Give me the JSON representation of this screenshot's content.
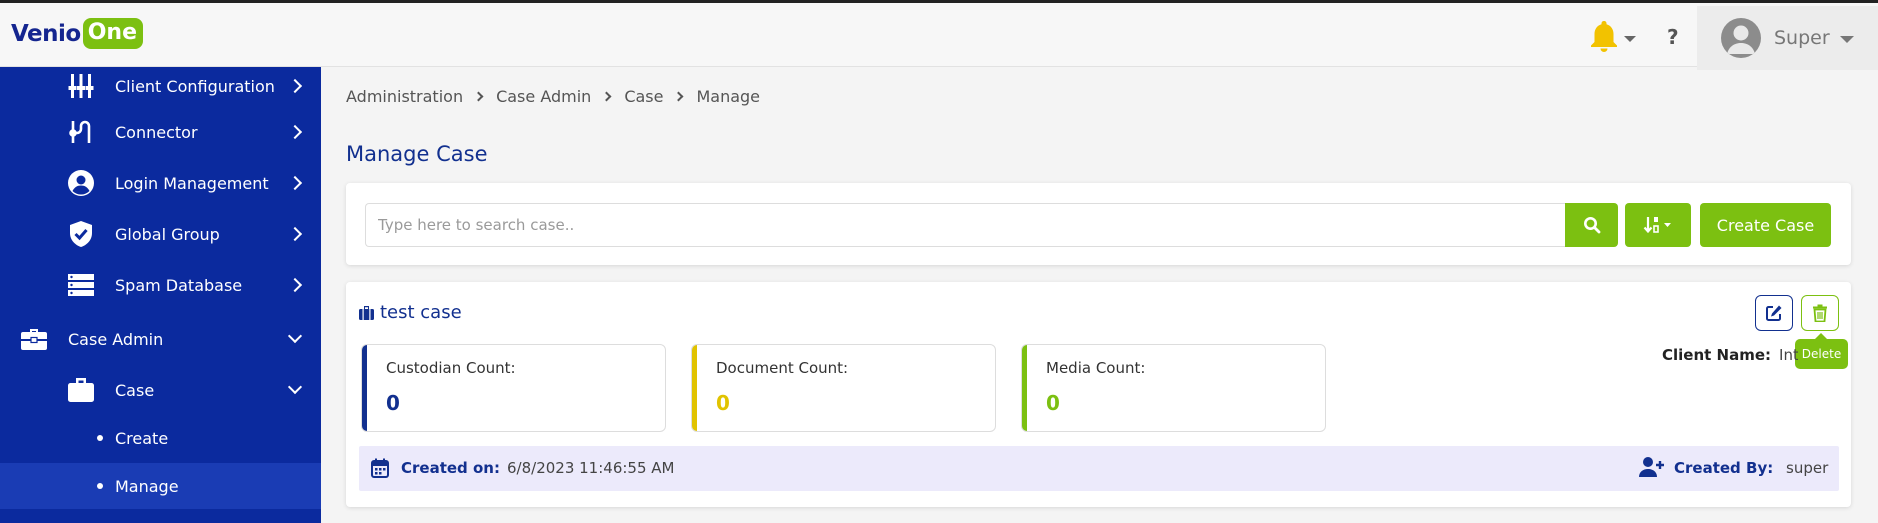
{
  "header": {
    "logo_part1": "Venio",
    "logo_part2": "One",
    "help_label": "?",
    "user_name": "Super"
  },
  "sidebar": {
    "items": [
      {
        "label": "Client Configuration",
        "icon": "client-config-icon",
        "expanded": false
      },
      {
        "label": "Connector",
        "icon": "connector-icon",
        "expanded": false
      },
      {
        "label": "Login Management",
        "icon": "user-circle-icon",
        "expanded": false
      },
      {
        "label": "Global Group",
        "icon": "shield-check-icon",
        "expanded": false
      },
      {
        "label": "Spam Database",
        "icon": "database-icon",
        "expanded": false
      },
      {
        "label": "Case Admin",
        "icon": "briefcase-icon",
        "expanded": true
      },
      {
        "label": "Case",
        "icon": "briefcase-icon",
        "expanded": true
      }
    ],
    "subitems": [
      {
        "label": "Create",
        "active": false
      },
      {
        "label": "Manage",
        "active": true
      }
    ]
  },
  "breadcrumb": [
    "Administration",
    "Case Admin",
    "Case",
    "Manage"
  ],
  "page_title": "Manage Case",
  "search": {
    "placeholder": "Type here to search case..",
    "value": "",
    "create_label": "Create Case"
  },
  "case": {
    "title": "test case",
    "delete_tooltip": "Delete",
    "client_name_label": "Client Name:",
    "client_name_value": "Int",
    "stats": [
      {
        "label": "Custodian Count:",
        "value": "0",
        "color": "#12308f"
      },
      {
        "label": "Document Count:",
        "value": "0",
        "color": "#e1c300"
      },
      {
        "label": "Media Count:",
        "value": "0",
        "color": "#7cc011"
      }
    ],
    "created_on_label": "Created on:",
    "created_on_value": "6/8/2023 11:46:55 AM",
    "created_by_label": "Created By:",
    "created_by_value": "super"
  },
  "colors": {
    "brand_blue": "#12308f",
    "sidebar_bg": "#0b2a9e",
    "accent_green": "#7cc011",
    "bell_yellow": "#f2c200"
  }
}
